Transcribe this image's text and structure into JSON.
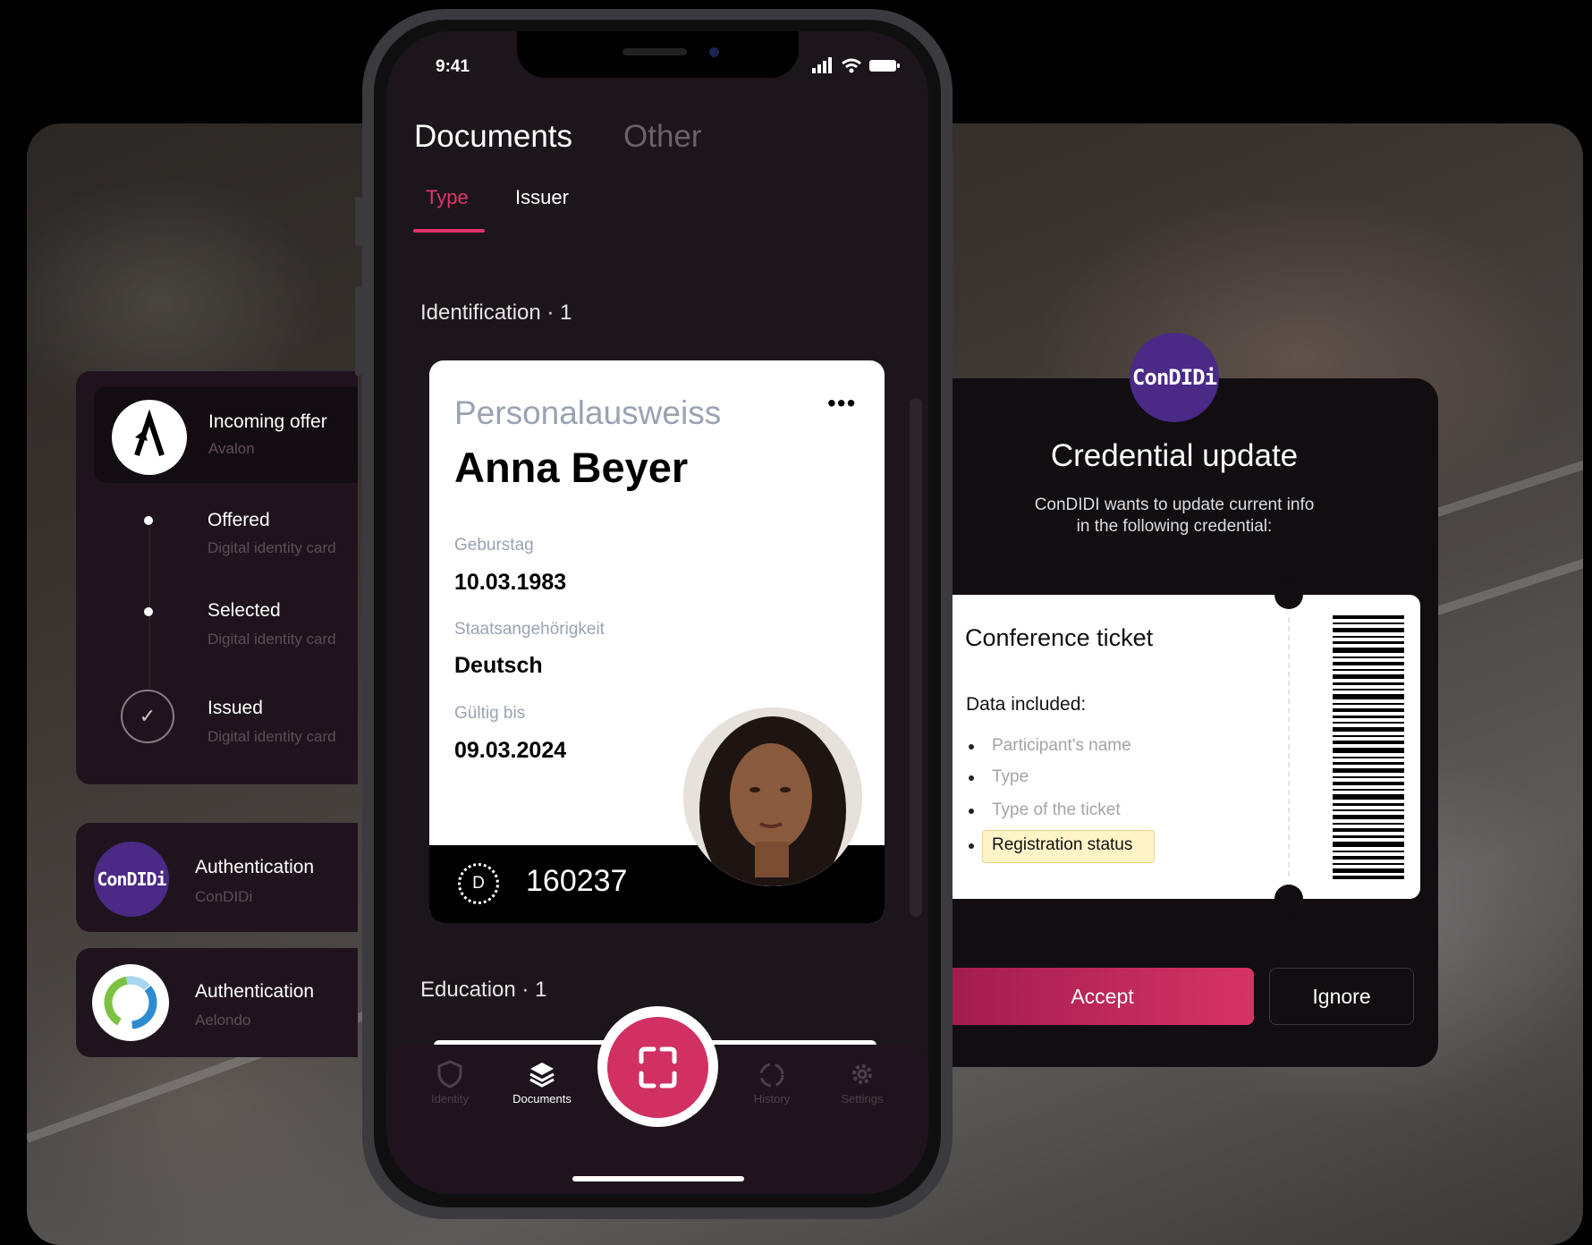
{
  "left_panel": {
    "offer": {
      "title": "Incoming offer",
      "subtitle": "Avalon"
    },
    "timeline": [
      {
        "title": "Offered",
        "subtitle": "Digital identity card"
      },
      {
        "title": "Selected",
        "subtitle": "Digital identity card"
      },
      {
        "title": "Issued",
        "subtitle": "Digital identity card"
      }
    ],
    "auth": [
      {
        "title": "Authentication",
        "subtitle": "ConDIDi",
        "logo_text": "ConDIDi"
      },
      {
        "title": "Authentication",
        "subtitle": "Aelondo"
      }
    ]
  },
  "phone": {
    "status": {
      "time": "9:41"
    },
    "segments": {
      "active": "Documents",
      "inactive": "Other"
    },
    "tabs": [
      {
        "label": "Type",
        "active": true
      },
      {
        "label": "Issuer",
        "active": false
      }
    ],
    "sections": {
      "identification": {
        "label": "Identification",
        "count": "1"
      },
      "education": {
        "label": "Education",
        "count": "1"
      }
    },
    "id_card": {
      "type": "Personalausweiss",
      "name": "Anna Beyer",
      "fields": [
        {
          "label": "Geburstag",
          "value": "10.03.1983"
        },
        {
          "label": "Staatsangehörigkeit",
          "value": "Deutsch"
        },
        {
          "label": "Gültig bis",
          "value": "09.03.2024"
        }
      ],
      "issuer_mark": "D",
      "number": "160237"
    },
    "nav": [
      {
        "label": "Identity",
        "icon": "shield-icon"
      },
      {
        "label": "Documents",
        "icon": "layers-icon",
        "active": true
      },
      {
        "label": "History",
        "icon": "history-icon"
      },
      {
        "label": "Settings",
        "icon": "gear-icon"
      }
    ]
  },
  "dialog": {
    "badge_text": "ConDIDi",
    "title": "Credential update",
    "desc_line1": "ConDIDI wants to update current info",
    "desc_line2": "in the following credential:",
    "ticket": {
      "title": "Conference ticket",
      "data_label": "Data included:",
      "items": [
        "Participant's name",
        "Type",
        "Type of the ticket",
        "Registration status"
      ]
    },
    "accept_label": "Accept",
    "ignore_label": "Ignore"
  },
  "colors": {
    "accent": "#e0346e",
    "accept_start": "#a31c4f",
    "accept_end": "#d63366",
    "condidi_purple": "#4a2a86",
    "screen_bg": "#1c151b",
    "highlight": "#fff4c8"
  }
}
